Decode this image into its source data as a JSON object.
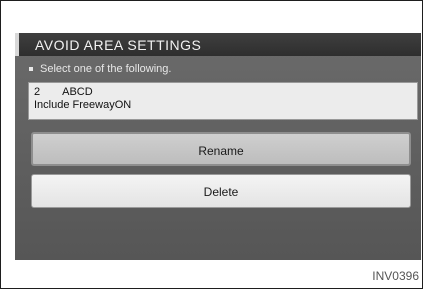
{
  "title": "AVOID AREA SETTINGS",
  "prompt": "Select one of the following.",
  "area": {
    "number": "2",
    "name": "ABCD",
    "freeway": "Include FreewayON"
  },
  "buttons": {
    "rename": "Rename",
    "delete": "Delete"
  },
  "figure_code": "INV0396"
}
